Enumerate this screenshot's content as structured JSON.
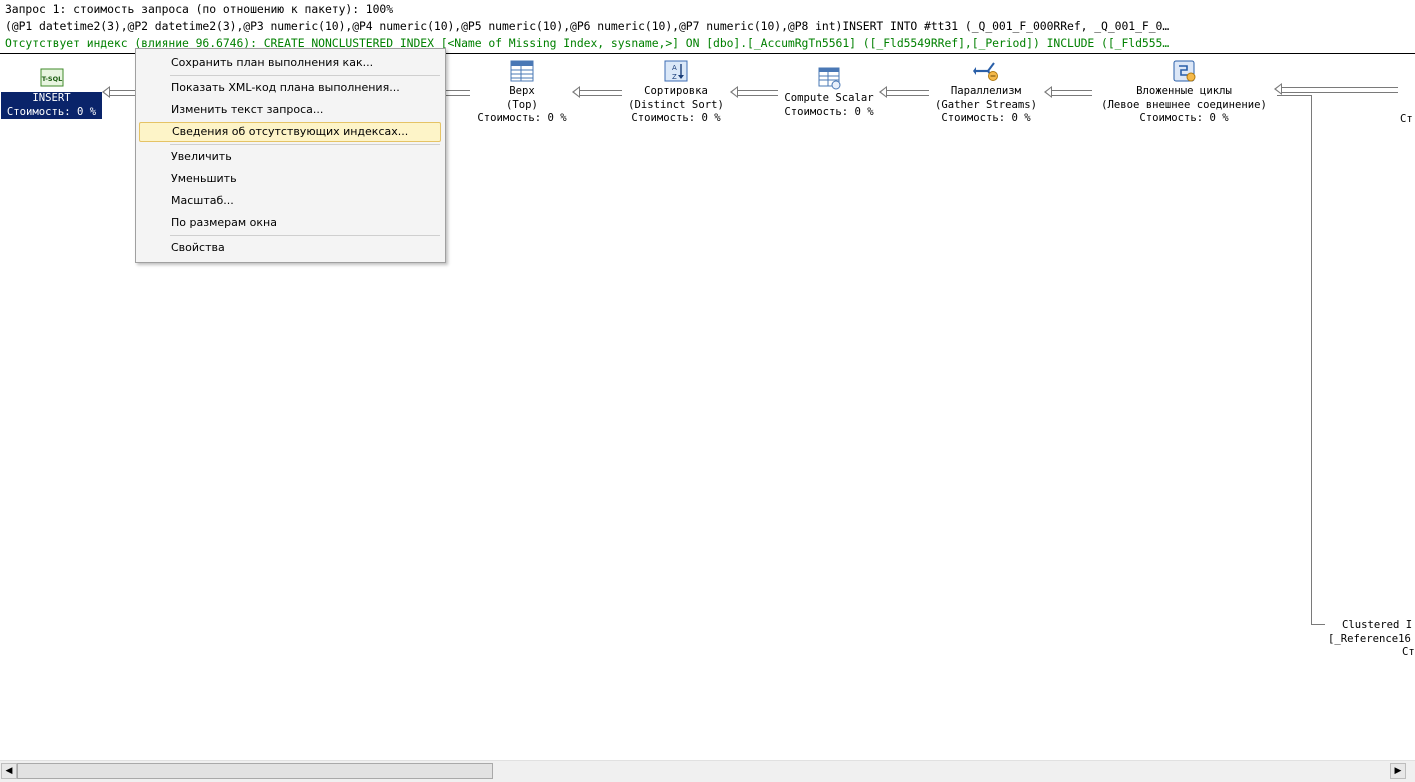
{
  "header": {
    "line1": "Запрос 1: стоимость запроса (по отношению к пакету): 100%",
    "line2": "(@P1 datetime2(3),@P2 datetime2(3),@P3 numeric(10),@P4 numeric(10),@P5 numeric(10),@P6 numeric(10),@P7 numeric(10),@P8 int)INSERT INTO #tt31 (_Q_001_F_000RRef, _Q_001_F_0…",
    "line3": "Отсутствует индекс (влияние 96.6746): CREATE NONCLUSTERED INDEX [<Name of Missing Index, sysname,>] ON [dbo].[_AccumRgTn5561] ([_Fld5549RRef],[_Period]) INCLUDE ([_Fld555…"
  },
  "plan": {
    "insert": {
      "icon": "tsql-icon",
      "badge": "T-SQL",
      "line1": "INSERT",
      "line2": "Стоимость: 0 %"
    },
    "top": {
      "icon": "table-icon",
      "line1": "Верх",
      "line2": "(Top)",
      "line3": "Стоимость: 0 %"
    },
    "sort": {
      "icon": "sort-icon",
      "line1": "Сортировка",
      "line2": "(Distinct Sort)",
      "line3": "Стоимость: 0 %"
    },
    "compute": {
      "icon": "compute-scalar-icon",
      "line1": "Compute Scalar",
      "line2": "Стоимость: 0 %"
    },
    "parallel": {
      "icon": "parallelism-icon",
      "line1": "Параллелизм",
      "line2": "(Gather Streams)",
      "line3": "Стоимость: 0 %"
    },
    "nested": {
      "icon": "nested-loops-icon",
      "line1": "Вложенные циклы",
      "line2": "(Левое внешнее соединение)",
      "line3": "Стоимость: 0 %"
    },
    "right_partial": "Ст",
    "clustered": {
      "line1": "Clustered I",
      "line2": "[_Reference16",
      "line3": "Ст"
    }
  },
  "context_menu": {
    "items": [
      "Сохранить план выполнения как...",
      "Показать XML-код плана выполнения...",
      "Изменить текст запроса...",
      "Сведения об отсутствующих индексах...",
      "Увеличить",
      "Уменьшить",
      "Масштаб...",
      "По размерам окна",
      "Свойства"
    ]
  },
  "scrollbar": {
    "left_arrow": "◀",
    "right_arrow": "▶"
  },
  "colors": {
    "selection": "#0a246a",
    "missing_index_text": "#008000",
    "menu_highlight": "#fdf4c8"
  }
}
